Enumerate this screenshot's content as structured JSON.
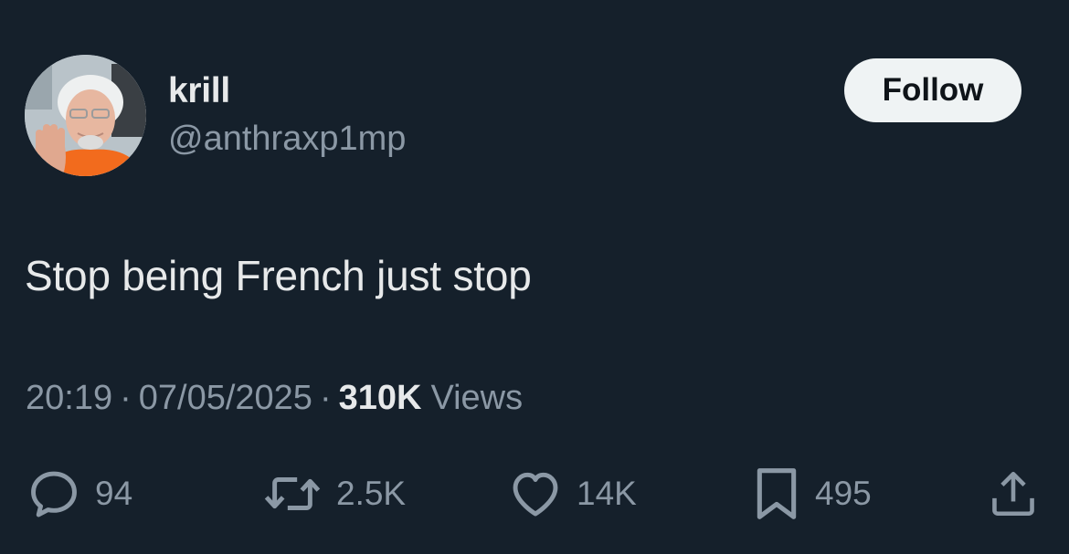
{
  "user": {
    "name": "krill",
    "handle": "@anthraxp1mp"
  },
  "follow_label": "Follow",
  "tweet": {
    "text": "Stop being French just stop",
    "time": "20:19",
    "date": "07/05/2025",
    "views_count": "310K",
    "views_label": "Views",
    "separator": "·"
  },
  "actions": {
    "replies": "94",
    "reposts": "2.5K",
    "likes": "14K",
    "bookmarks": "495"
  },
  "colors": {
    "background": "#15202b",
    "primary_text": "#e7e9ea",
    "secondary_text": "#8b98a5",
    "follow_button": "#eff3f4"
  },
  "icons": [
    "reply-icon",
    "repost-icon",
    "like-icon",
    "bookmark-icon",
    "share-icon"
  ]
}
